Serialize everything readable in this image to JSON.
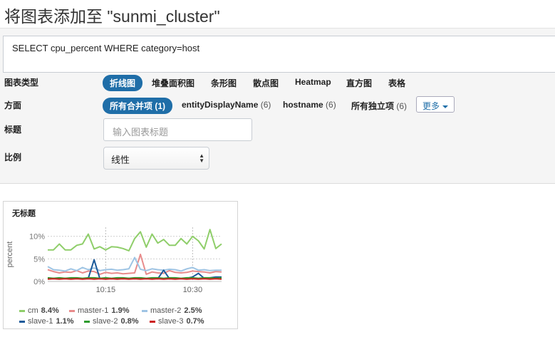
{
  "header": {
    "title": "将图表添加至 \"sunmi_cluster\""
  },
  "query": {
    "text": "SELECT cpu_percent WHERE category=host"
  },
  "chart_type": {
    "label": "图表类型",
    "options": [
      "折线图",
      "堆叠面积图",
      "条形图",
      "散点图",
      "Heatmap",
      "直方图",
      "表格"
    ],
    "selected": "折线图"
  },
  "facets": {
    "label": "方面",
    "selected": "所有合并项 (1)",
    "options": [
      {
        "name": "entityDisplayName",
        "count": "(6)"
      },
      {
        "name": "hostname",
        "count": "(6)"
      },
      {
        "name": "所有独立项",
        "count": "(6)"
      }
    ],
    "more_label": "更多"
  },
  "title_field": {
    "label": "标题",
    "placeholder": "输入图表标题"
  },
  "scale": {
    "label": "比例",
    "value": "线性"
  },
  "chart_card": {
    "title": "无标题"
  },
  "chart_data": {
    "type": "line",
    "title": "无标题",
    "ylabel": "percent",
    "xlabel": "",
    "yticks": [
      "0%",
      "5%",
      "10%"
    ],
    "ylim": [
      0,
      12
    ],
    "xticks": [
      "10:15",
      "10:30"
    ],
    "x": [
      "10:05",
      "10:06",
      "10:07",
      "10:08",
      "10:09",
      "10:10",
      "10:11",
      "10:12",
      "10:13",
      "10:14",
      "10:15",
      "10:16",
      "10:17",
      "10:18",
      "10:19",
      "10:20",
      "10:21",
      "10:22",
      "10:23",
      "10:24",
      "10:25",
      "10:26",
      "10:27",
      "10:28",
      "10:29",
      "10:30",
      "10:31",
      "10:32",
      "10:33",
      "10:34",
      "10:35"
    ],
    "series": [
      {
        "name": "cm",
        "color": "#8fce6a",
        "stat": "8.4%",
        "values": [
          7.0,
          7.0,
          8.3,
          7.0,
          7.0,
          8.0,
          8.3,
          10.5,
          7.2,
          7.7,
          7.0,
          7.7,
          7.6,
          7.3,
          6.8,
          9.5,
          11.0,
          7.6,
          10.5,
          8.5,
          9.3,
          8.0,
          8.0,
          9.5,
          8.3,
          10.0,
          9.0,
          7.2,
          11.5,
          7.3,
          8.3
        ]
      },
      {
        "name": "master-1",
        "color": "#e88b8b",
        "stat": "1.9%",
        "values": [
          2.6,
          2.2,
          1.9,
          2.1,
          2.0,
          2.4,
          1.9,
          2.3,
          2.2,
          1.6,
          2.0,
          1.8,
          1.9,
          1.7,
          1.8,
          1.9,
          6.0,
          1.6,
          2.1,
          1.9,
          1.8,
          2.4,
          2.0,
          1.9,
          2.0,
          2.3,
          2.2,
          2.1,
          1.9,
          2.2,
          2.1
        ]
      },
      {
        "name": "master-2",
        "color": "#9ec4e4",
        "stat": "2.5%",
        "values": [
          3.3,
          2.6,
          2.5,
          2.3,
          2.8,
          2.4,
          3.1,
          2.6,
          3.0,
          2.4,
          2.6,
          2.7,
          2.5,
          2.6,
          2.8,
          5.3,
          2.7,
          2.4,
          2.8,
          2.6,
          2.5,
          2.7,
          2.6,
          2.3,
          2.8,
          3.1,
          2.5,
          2.6,
          2.4,
          2.5,
          2.5
        ]
      },
      {
        "name": "slave-1",
        "color": "#1b5a9a",
        "stat": "1.1%",
        "values": [
          0.6,
          0.7,
          0.6,
          0.7,
          0.6,
          0.7,
          0.6,
          0.7,
          4.8,
          0.6,
          0.7,
          0.6,
          0.7,
          0.6,
          0.7,
          0.6,
          0.7,
          0.6,
          0.7,
          0.6,
          2.5,
          0.6,
          0.7,
          0.6,
          0.7,
          1.0,
          1.8,
          0.7,
          0.8,
          1.0,
          1.0
        ]
      },
      {
        "name": "slave-2",
        "color": "#2e9b2e",
        "stat": "0.8%",
        "values": [
          0.8,
          0.7,
          0.8,
          0.7,
          0.8,
          0.8,
          0.7,
          0.8,
          0.8,
          0.7,
          0.8,
          0.7,
          0.8,
          0.8,
          0.7,
          0.8,
          0.8,
          0.7,
          0.8,
          0.8,
          0.7,
          0.8,
          0.8,
          0.7,
          0.8,
          0.8,
          0.7,
          0.8,
          0.8,
          0.7,
          0.8
        ]
      },
      {
        "name": "slave-3",
        "color": "#cc1f1f",
        "stat": "0.7%",
        "values": [
          0.5,
          0.6,
          0.5,
          0.6,
          0.5,
          0.6,
          0.5,
          0.6,
          0.5,
          0.6,
          0.5,
          0.6,
          0.5,
          0.6,
          0.5,
          0.6,
          0.5,
          0.6,
          0.5,
          0.6,
          0.5,
          0.6,
          0.5,
          0.6,
          0.5,
          0.6,
          0.5,
          0.6,
          0.5,
          0.6,
          0.5
        ]
      }
    ]
  }
}
